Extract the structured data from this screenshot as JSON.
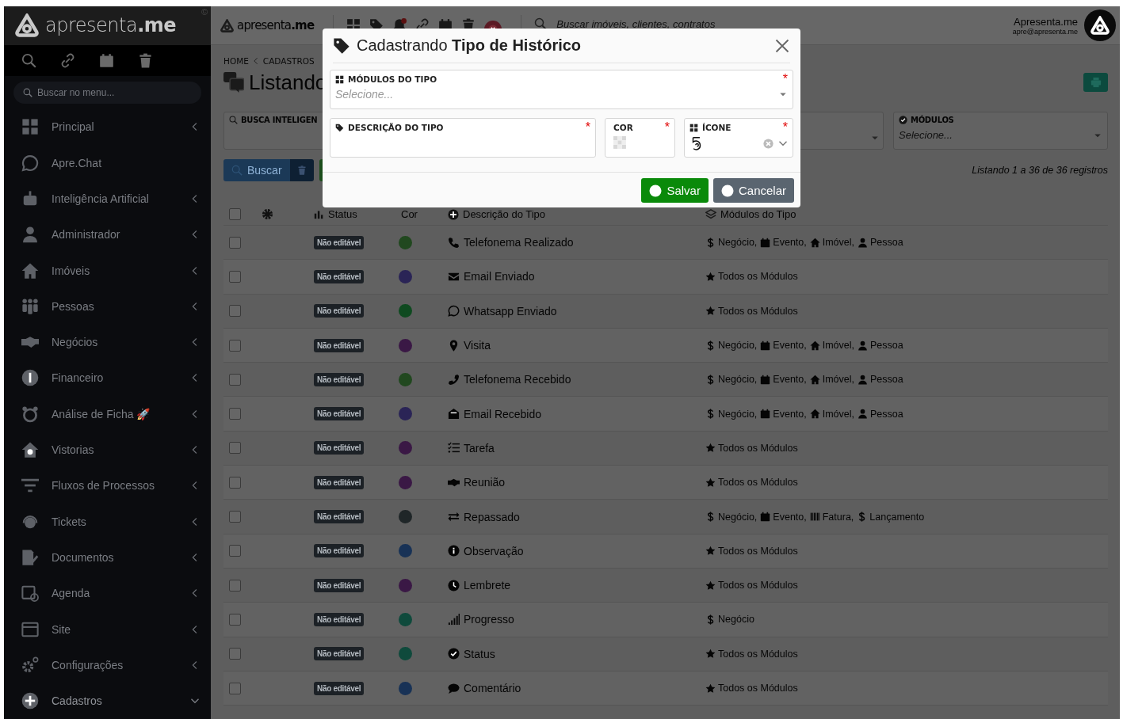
{
  "sidebar": {
    "logo": {
      "text": "apresenta",
      "accent": ".me",
      "mark": "©"
    },
    "search": {
      "placeholder": "Buscar no menu..."
    },
    "items": [
      {
        "label": "Principal",
        "kind": "group",
        "expanded": false
      },
      {
        "label": "Apre.Chat",
        "kind": "link"
      },
      {
        "label": "Inteligência Artificial",
        "kind": "group",
        "expanded": false
      },
      {
        "label": "Administrador",
        "kind": "group",
        "expanded": false
      },
      {
        "label": "Imóveis",
        "kind": "group",
        "expanded": false
      },
      {
        "label": "Pessoas",
        "kind": "group",
        "expanded": false
      },
      {
        "label": "Negócios",
        "kind": "group",
        "expanded": false
      },
      {
        "label": "Financeiro",
        "kind": "group",
        "expanded": false
      },
      {
        "label": "Análise de Ficha 🚀",
        "kind": "group",
        "expanded": false
      },
      {
        "label": "Vistorias",
        "kind": "group",
        "expanded": false
      },
      {
        "label": "Fluxos de Processos",
        "kind": "group",
        "expanded": false
      },
      {
        "label": "Tickets",
        "kind": "group",
        "expanded": false
      },
      {
        "label": "Documentos",
        "kind": "group",
        "expanded": false
      },
      {
        "label": "Agenda",
        "kind": "group",
        "expanded": false
      },
      {
        "label": "Site",
        "kind": "group",
        "expanded": false
      },
      {
        "label": "Configurações",
        "kind": "group",
        "expanded": false
      },
      {
        "label": "Cadastros",
        "kind": "group",
        "expanded": true
      }
    ]
  },
  "topbar": {
    "logo": {
      "text": "apresenta",
      "accent": ".me"
    },
    "search": {
      "placeholder": "Buscar imóveis, clientes, contratos"
    },
    "user": {
      "name": "Apresenta.me",
      "email": "apre@apresenta.me"
    }
  },
  "breadcrumb": [
    "HOME",
    "CADASTROS"
  ],
  "page_title": "Listando",
  "filters": [
    {
      "label": "BUSCA INTELIGEN"
    },
    {
      "label": "MÓDULOS",
      "placeholder": "Selecione..."
    }
  ],
  "search_button": "Buscar",
  "record_count": "Listando 1 a 36 de 36 registros",
  "table": {
    "columns": [
      "Status",
      "Cor",
      "Descrição do Tipo",
      "Módulos do Tipo"
    ],
    "header_checked": false,
    "rows": [
      {
        "checked": false,
        "status": "Não editável",
        "color": "#21481f",
        "description": "Telefonema Realizado",
        "modules": [
          {
            "kind": "deal",
            "label": "Negócio,"
          },
          {
            "kind": "event",
            "label": "Evento,"
          },
          {
            "kind": "property",
            "label": "Imóvel,"
          },
          {
            "kind": "person",
            "label": "Pessoa"
          }
        ]
      },
      {
        "checked": false,
        "status": "Não editável",
        "color": "#2a2456",
        "description": "Email Enviado",
        "modules": [
          {
            "kind": "all",
            "label": "Todos os Módulos"
          }
        ]
      },
      {
        "checked": false,
        "status": "Não editável",
        "color": "#0f4a20",
        "description": "Whatsapp Enviado",
        "modules": [
          {
            "kind": "all",
            "label": "Todos os Módulos"
          }
        ]
      },
      {
        "checked": false,
        "status": "Não editável",
        "color": "#3a1845",
        "description": "Visita",
        "modules": [
          {
            "kind": "deal",
            "label": "Negócio,"
          },
          {
            "kind": "event",
            "label": "Evento,"
          },
          {
            "kind": "property",
            "label": "Imóvel,"
          },
          {
            "kind": "person",
            "label": "Pessoa"
          }
        ]
      },
      {
        "checked": false,
        "status": "Não editável",
        "color": "#21481f",
        "description": "Telefonema Recebido",
        "modules": [
          {
            "kind": "deal",
            "label": "Negócio,"
          },
          {
            "kind": "event",
            "label": "Evento,"
          },
          {
            "kind": "property",
            "label": "Imóvel,"
          },
          {
            "kind": "person",
            "label": "Pessoa"
          }
        ]
      },
      {
        "checked": false,
        "status": "Não editável",
        "color": "#2a2456",
        "description": "Email Recebido",
        "modules": [
          {
            "kind": "deal",
            "label": "Negócio,"
          },
          {
            "kind": "event",
            "label": "Evento,"
          },
          {
            "kind": "property",
            "label": "Imóvel,"
          },
          {
            "kind": "person",
            "label": "Pessoa"
          }
        ]
      },
      {
        "checked": false,
        "status": "Não editável",
        "color": "#3a1845",
        "description": "Tarefa",
        "modules": [
          {
            "kind": "all",
            "label": "Todos os Módulos"
          }
        ]
      },
      {
        "checked": false,
        "status": "Não editável",
        "color": "#3a1845",
        "description": "Reunião",
        "modules": [
          {
            "kind": "all",
            "label": "Todos os Módulos"
          }
        ]
      },
      {
        "checked": false,
        "status": "Não editável",
        "color": "#1f2628",
        "description": "Repassado",
        "modules": [
          {
            "kind": "deal",
            "label": "Negócio,"
          },
          {
            "kind": "event",
            "label": "Evento,"
          },
          {
            "kind": "invoice",
            "label": "Fatura,"
          },
          {
            "kind": "entry",
            "label": "Lançamento"
          }
        ]
      },
      {
        "checked": false,
        "status": "Não editável",
        "color": "#183256",
        "description": "Observação",
        "modules": [
          {
            "kind": "all",
            "label": "Todos os Módulos"
          }
        ]
      },
      {
        "checked": false,
        "status": "Não editável",
        "color": "#3a1845",
        "description": "Lembrete",
        "modules": [
          {
            "kind": "all",
            "label": "Todos os Módulos"
          }
        ]
      },
      {
        "checked": false,
        "status": "Não editável",
        "color": "#0f4a3c",
        "description": "Progresso",
        "modules": [
          {
            "kind": "deal",
            "label": "Negócio"
          }
        ]
      },
      {
        "checked": false,
        "status": "Não editável",
        "color": "#0f4a3c",
        "description": "Status",
        "modules": [
          {
            "kind": "all",
            "label": "Todos os Módulos"
          }
        ]
      },
      {
        "checked": false,
        "status": "Não editável",
        "color": "#183256",
        "description": "Comentário",
        "modules": [
          {
            "kind": "all",
            "label": "Todos os Módulos"
          }
        ]
      }
    ]
  },
  "modal": {
    "title": "Cadastrando **Tipo de Histórico**",
    "modules_field": {
      "label": "MÓDULOS DO TIPO",
      "required_mark": "*",
      "placeholder": "Selecione..."
    },
    "description_field": {
      "label": "DESCRIÇÃO DO TIPO",
      "required_mark": "*"
    },
    "color_field": {
      "label": "COR",
      "required_mark": "*"
    },
    "icon_field": {
      "label": "ÍCONE",
      "required_mark": "*"
    },
    "buttons": [
      {
        "label": "Salvar",
        "kind": "primary"
      },
      {
        "label": "Cancelar",
        "kind": "secondary"
      }
    ]
  }
}
